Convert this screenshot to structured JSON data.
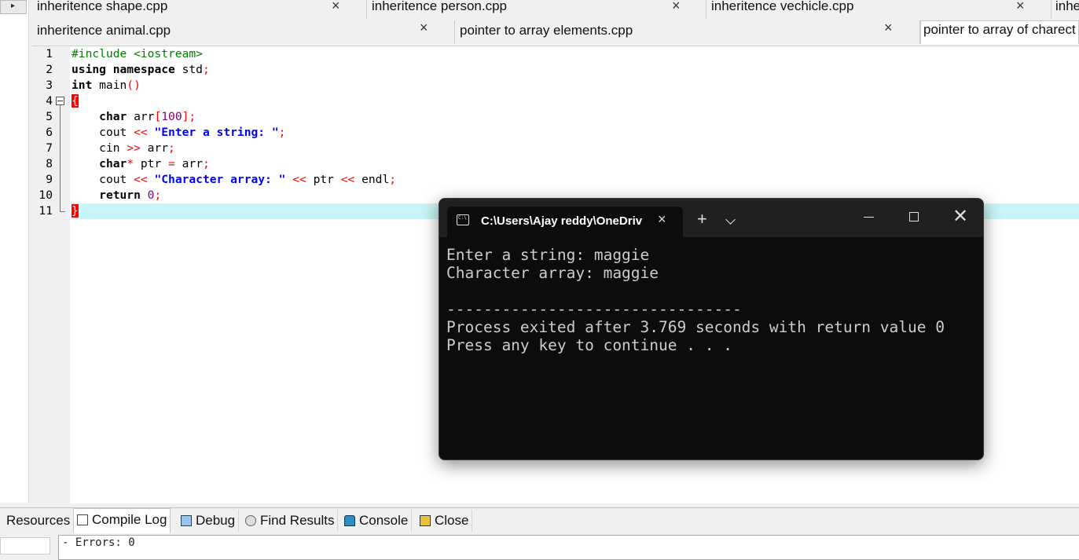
{
  "tabs_row1": [
    {
      "label": "inheritence shape.cpp",
      "close": "×"
    },
    {
      "label": "inheritence person.cpp",
      "close": "×"
    },
    {
      "label": "inheritence vechicle.cpp",
      "close": "×"
    },
    {
      "label": "inhe"
    }
  ],
  "tabs_row2": [
    {
      "label": "inheritence animal.cpp",
      "close": "×"
    },
    {
      "label": "pointer to array elements.cpp",
      "close": "×"
    },
    {
      "label": "pointer to array of charect"
    }
  ],
  "active_tab": "pointer to array of charect",
  "line_numbers": [
    "1",
    "2",
    "3",
    "4",
    "5",
    "6",
    "7",
    "8",
    "9",
    "10",
    "11"
  ],
  "code": {
    "l1_include": "#include <iostream>",
    "l2_using": "using",
    "l2_namespace": "namespace",
    "l2_std": " std",
    "l2_semi": ";",
    "l3_int": "int",
    "l3_main": " main",
    "l3_parens": "()",
    "l4_brace": "{",
    "l5_char": "char",
    "l5_arr": " arr",
    "l5_open": "[",
    "l5_num": "100",
    "l5_close": "];",
    "l6_cout": "cout ",
    "l6_op": "<<",
    "l6_str": "\"Enter a string: \"",
    "l6_semi": ";",
    "l7_cin": "cin ",
    "l7_op": ">>",
    "l7_arr": " arr",
    "l7_semi": ";",
    "l8_char": "char",
    "l8_star": "*",
    "l8_ptr": " ptr ",
    "l8_eq": "=",
    "l8_arr": " arr",
    "l8_semi": ";",
    "l9_cout": "cout ",
    "l9_op1": "<<",
    "l9_str": "\"Character array: \"",
    "l9_op2": "<<",
    "l9_ptr": " ptr ",
    "l9_op3": "<<",
    "l9_endl": " endl",
    "l9_semi": ";",
    "l10_return": "return",
    "l10_num": "0",
    "l10_semi": ";",
    "l11_brace": "}"
  },
  "terminal": {
    "title": "C:\\Users\\Ajay reddy\\OneDrive",
    "close": "×",
    "plus": "+",
    "window_close": "✕",
    "lines": [
      "Enter a string: maggie",
      "Character array: maggie",
      "",
      "--------------------------------",
      "Process exited after 3.769 seconds with return value 0",
      "Press any key to continue . . ."
    ]
  },
  "bottom_tabs": {
    "resources": "Resources",
    "compile_log": "Compile Log",
    "debug": "Debug",
    "find_results": "Find Results",
    "console": "Console",
    "close": "Close"
  },
  "log_text": "- Errors: 0",
  "colors": {
    "keyword": "#000000",
    "preprocessor": "#008000",
    "string": "#0000ff",
    "operator": "#ff0000",
    "number": "#800080",
    "current_line": "#c8f5f5",
    "terminal_bg": "#0c0c0c"
  }
}
